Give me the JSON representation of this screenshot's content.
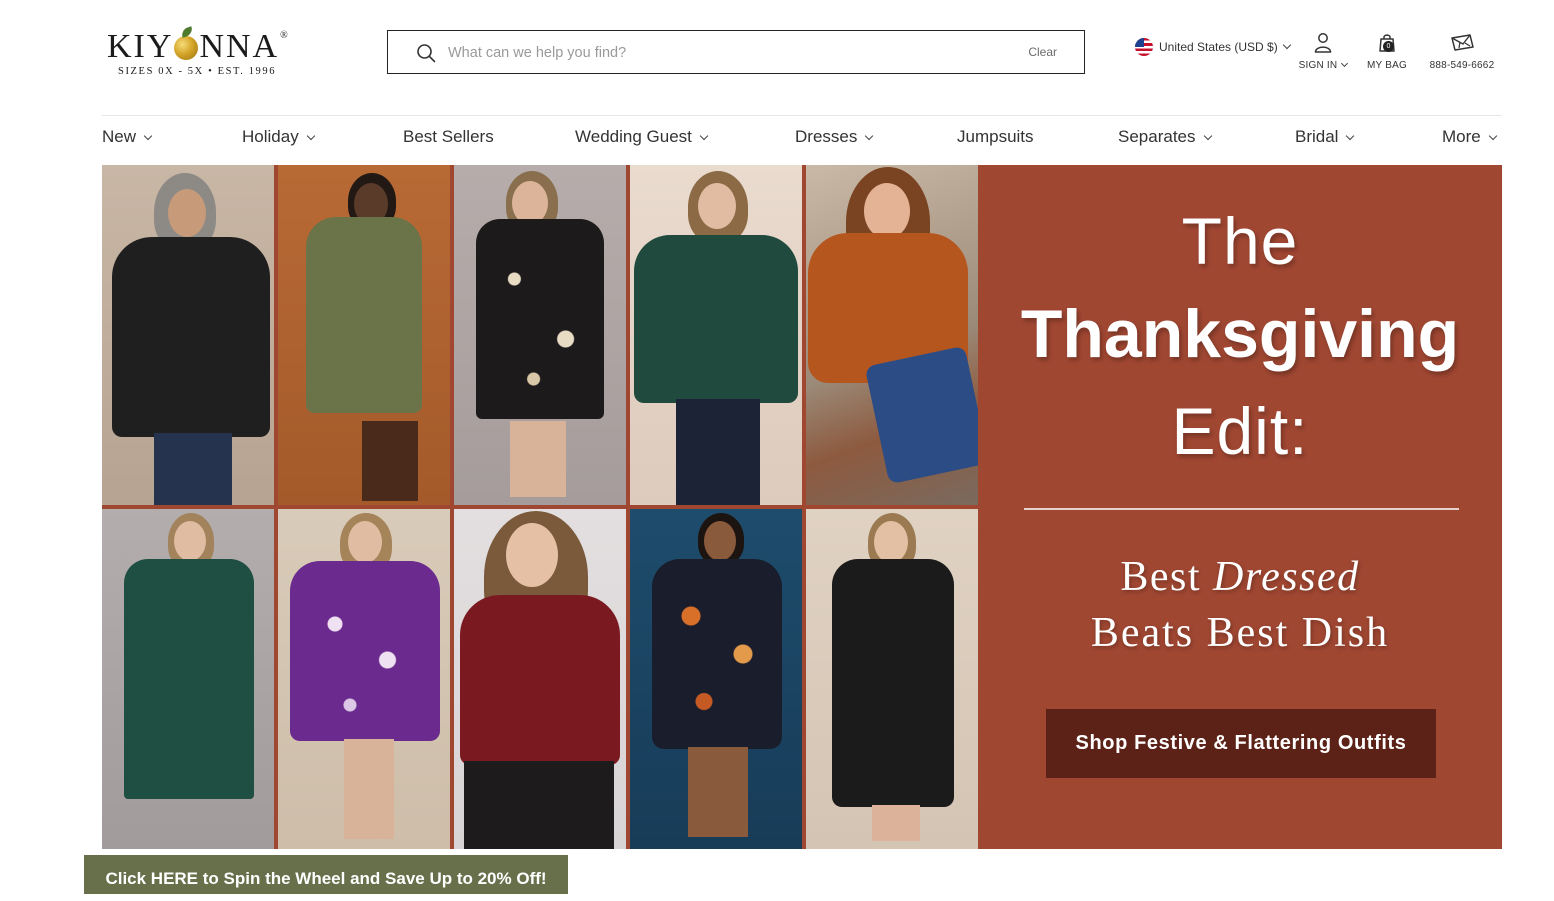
{
  "brand": {
    "logo_word_left": "KIY",
    "logo_word_right": "NNA",
    "logo_reg": "®",
    "tagline": "SIZES 0X - 5X  •  EST. 1996"
  },
  "search": {
    "placeholder": "What can we help you find?",
    "value": "",
    "clear_label": "Clear"
  },
  "header": {
    "country_label": "United States (USD $)",
    "sign_in_label": "SIGN IN",
    "bag_label": "MY BAG",
    "bag_count": "0",
    "phone_label": "888-549-6662"
  },
  "nav": {
    "items": [
      {
        "label": "New",
        "has_dropdown": true
      },
      {
        "label": "Holiday",
        "has_dropdown": true
      },
      {
        "label": "Best Sellers",
        "has_dropdown": false
      },
      {
        "label": "Wedding Guest",
        "has_dropdown": true
      },
      {
        "label": "Dresses",
        "has_dropdown": true
      },
      {
        "label": "Jumpsuits",
        "has_dropdown": false
      },
      {
        "label": "Separates",
        "has_dropdown": true
      },
      {
        "label": "Bridal",
        "has_dropdown": true
      },
      {
        "label": "More",
        "has_dropdown": true
      }
    ]
  },
  "hero": {
    "line_the": "The",
    "line_big": "Thanksgiving",
    "line_edit": "Edit:",
    "subline_a": "Best ",
    "subline_em": "Dressed",
    "subline_b": "Beats Best Dish",
    "cta_label": "Shop Festive & Flattering Outfits",
    "product_photos": [
      "model-black-cowl-sweater",
      "model-olive-sweater-dress",
      "model-black-floral-wrap-dress",
      "model-green-wrap-top",
      "model-rust-turtleneck-sweater",
      "model-green-jumpsuit",
      "model-purple-floral-wrap-dress",
      "model-burgundy-wrap-top",
      "model-navy-floral-dress",
      "model-black-midi-dress"
    ]
  },
  "promo_banner": {
    "label": "Click HERE to Spin the Wheel and Save Up to 20% Off!"
  },
  "colors": {
    "hero_rust": "#a04732",
    "cta_dark": "#5c2218",
    "banner_olive": "#67704b",
    "text": "#2d2d2d"
  }
}
